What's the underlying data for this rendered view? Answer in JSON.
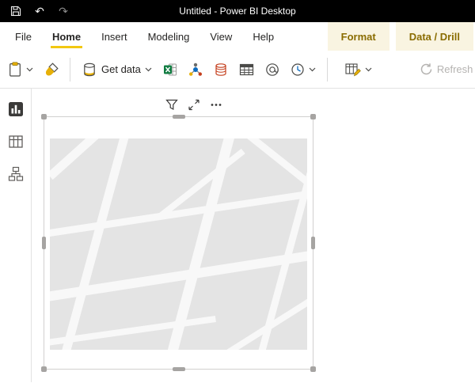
{
  "titlebar": {
    "title": "Untitled - Power BI Desktop",
    "undo_glyph": "↶",
    "redo_glyph": "↷"
  },
  "menubar": {
    "items": [
      {
        "label": "File"
      },
      {
        "label": "Home"
      },
      {
        "label": "Insert"
      },
      {
        "label": "Modeling"
      },
      {
        "label": "View"
      },
      {
        "label": "Help"
      }
    ],
    "active_item": "Home",
    "contextual_tabs": [
      {
        "label": "Format"
      },
      {
        "label": "Data / Drill"
      }
    ]
  },
  "ribbon": {
    "paste": {
      "icon": "clipboard-icon"
    },
    "format_painter": {
      "icon": "format-painter-icon"
    },
    "get_data": {
      "label": "Get data",
      "icon": "database-icon"
    },
    "excel": {
      "icon": "excel-workbook-icon"
    },
    "data_hub": {
      "icon": "data-hub-icon"
    },
    "sql_server": {
      "icon": "sql-server-icon"
    },
    "enter_data": {
      "icon": "enter-data-table-icon"
    },
    "dataverse": {
      "icon": "dataverse-icon"
    },
    "recent_sources": {
      "icon": "recent-sources-clock-icon"
    },
    "transform_data": {
      "icon": "transform-data-icon"
    },
    "refresh": {
      "label": "Refresh",
      "icon": "refresh-icon",
      "disabled": true
    }
  },
  "view_switcher": {
    "items": [
      {
        "name": "report-view",
        "active": true
      },
      {
        "name": "table-view",
        "active": false
      },
      {
        "name": "model-view",
        "active": false
      }
    ]
  },
  "canvas": {
    "visual": {
      "type": "map-visual",
      "selected": true,
      "header_icons": [
        "filter-icon",
        "focus-mode-icon",
        "more-options-icon"
      ]
    }
  },
  "colors": {
    "titlebar_bg": "#000000",
    "accent_yellow": "#f2c811",
    "contextual_tab_text": "#8a6c00",
    "contextual_tab_bg": "#f9f4e1",
    "map_block": "#e4e4e4",
    "map_street": "#f8f8f8",
    "disabled_gray": "#b5b3b1"
  }
}
